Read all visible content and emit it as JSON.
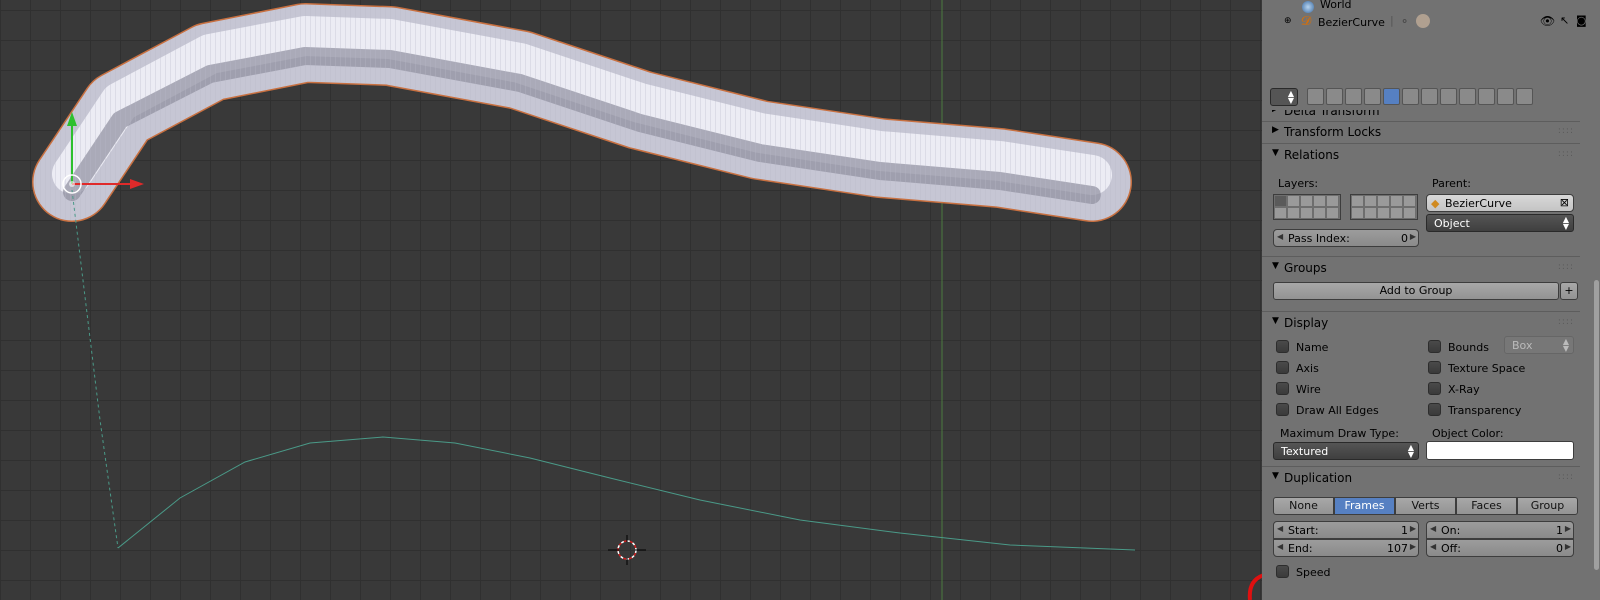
{
  "outliner": {
    "world_label": "World",
    "curve_label": "BezierCurve"
  },
  "properties": {
    "delta_transform": "Delta Transform",
    "transform_locks": "Transform Locks",
    "relations": {
      "title": "Relations",
      "layers_label": "Layers:",
      "parent_label": "Parent:",
      "parent_value": "BezierCurve",
      "parent_type": "Object",
      "pass_index_label": "Pass Index:",
      "pass_index_value": "0"
    },
    "groups": {
      "title": "Groups",
      "add_button": "Add to Group"
    },
    "display": {
      "title": "Display",
      "name": "Name",
      "axis": "Axis",
      "wire": "Wire",
      "draw_all_edges": "Draw All Edges",
      "bounds": "Bounds",
      "bounds_type": "Box",
      "texture_space": "Texture Space",
      "xray": "X-Ray",
      "transparency": "Transparency",
      "max_draw_type_label": "Maximum Draw Type:",
      "max_draw_type_value": "Textured",
      "object_color_label": "Object Color:",
      "object_color": "#ffffff"
    },
    "duplication": {
      "title": "Duplication",
      "modes": [
        "None",
        "Frames",
        "Verts",
        "Faces",
        "Group"
      ],
      "active_mode": "Frames",
      "start_label": "Start:",
      "start_value": "1",
      "end_label": "End:",
      "end_value": "107",
      "on_label": "On:",
      "on_value": "1",
      "off_label": "Off:",
      "off_value": "0",
      "speed_label": "Speed"
    }
  },
  "colors": {
    "accent": "#5680c2",
    "panel_bg": "#727272",
    "viewport_bg": "#393939",
    "path_line": "#4a9a88"
  }
}
